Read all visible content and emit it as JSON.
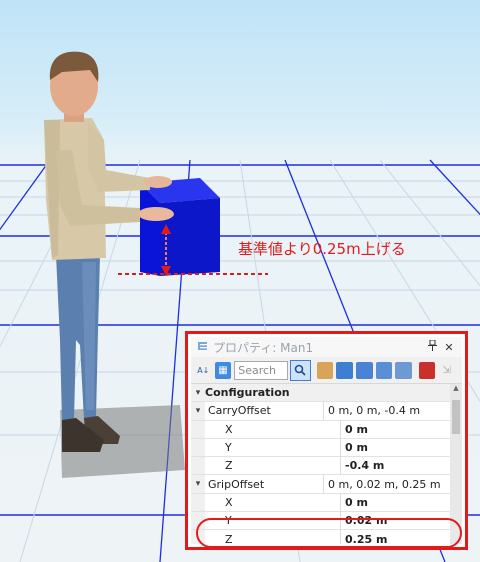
{
  "scene": {
    "annotation_text": "基準値より0.25m上げる",
    "colors": {
      "box": "#0a14d8",
      "grid_blue": "#1e2ee0",
      "grid_light": "#c9d6e6",
      "annotation": "#e01b1b"
    }
  },
  "panel": {
    "title": "プロパティ: Man1",
    "pin_icon": "pin-icon",
    "close_icon": "close-icon",
    "toolbar": {
      "sort_icon": "sort-az-icon",
      "category_icon": "category-view-icon",
      "search_placeholder": "Search",
      "search_icon": "magnifier-icon"
    },
    "category": {
      "label": "Configuration",
      "expander": "▾"
    },
    "rows": [
      {
        "kind": "par",
        "expander": "▾",
        "name": "CarryOffset",
        "value": "0 m, 0 m, -0.4 m"
      },
      {
        "kind": "sub",
        "name": "X",
        "value": "0 m"
      },
      {
        "kind": "sub",
        "name": "Y",
        "value": "0 m"
      },
      {
        "kind": "sub",
        "name": "Z",
        "value": "-0.4 m"
      },
      {
        "kind": "par",
        "expander": "▾",
        "name": "GripOffset",
        "value": "0 m, 0.02 m, 0.25 m"
      },
      {
        "kind": "sub",
        "name": "X",
        "value": "0 m"
      },
      {
        "kind": "sub",
        "name": "Y",
        "value": "0.02 m"
      },
      {
        "kind": "sub",
        "name": "Z",
        "value": "0.25 m"
      }
    ]
  }
}
